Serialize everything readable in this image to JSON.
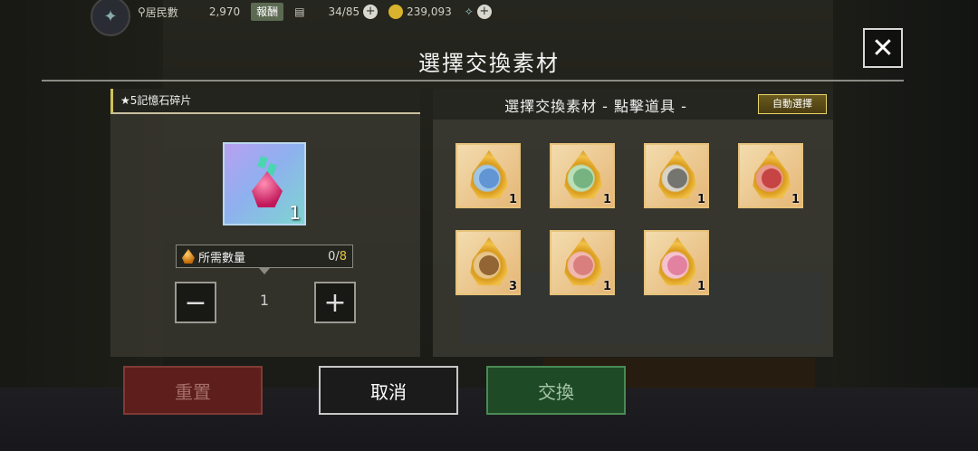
{
  "topbar": {
    "residents_label": "居民數",
    "residents_value": "2,970",
    "tag_label": "報酬",
    "capacity": "34/85",
    "gold": "239,093"
  },
  "dialog": {
    "title": "選擇交換素材",
    "close_label": "✕"
  },
  "left": {
    "item_name": "★5記憶石碎片",
    "item_qty": "1",
    "need_label": "所需數量",
    "need_current": "0/",
    "need_total": "8",
    "minus_label": "−",
    "plus_label": "+",
    "step_value": "1"
  },
  "right": {
    "header": "選擇交換素材 - 點擊道具 -",
    "auto_button": "自動選擇",
    "materials": [
      {
        "count": "1"
      },
      {
        "count": "1"
      },
      {
        "count": "1"
      },
      {
        "count": "1"
      },
      {
        "count": "3"
      },
      {
        "count": "1"
      },
      {
        "count": "1"
      }
    ]
  },
  "buttons": {
    "reset": "重置",
    "cancel": "取消",
    "exchange": "交換"
  },
  "colors": {
    "accent_gold": "#e3c53c",
    "reset_red": "#5e1f1c",
    "exchange_green": "#1e4a26"
  }
}
